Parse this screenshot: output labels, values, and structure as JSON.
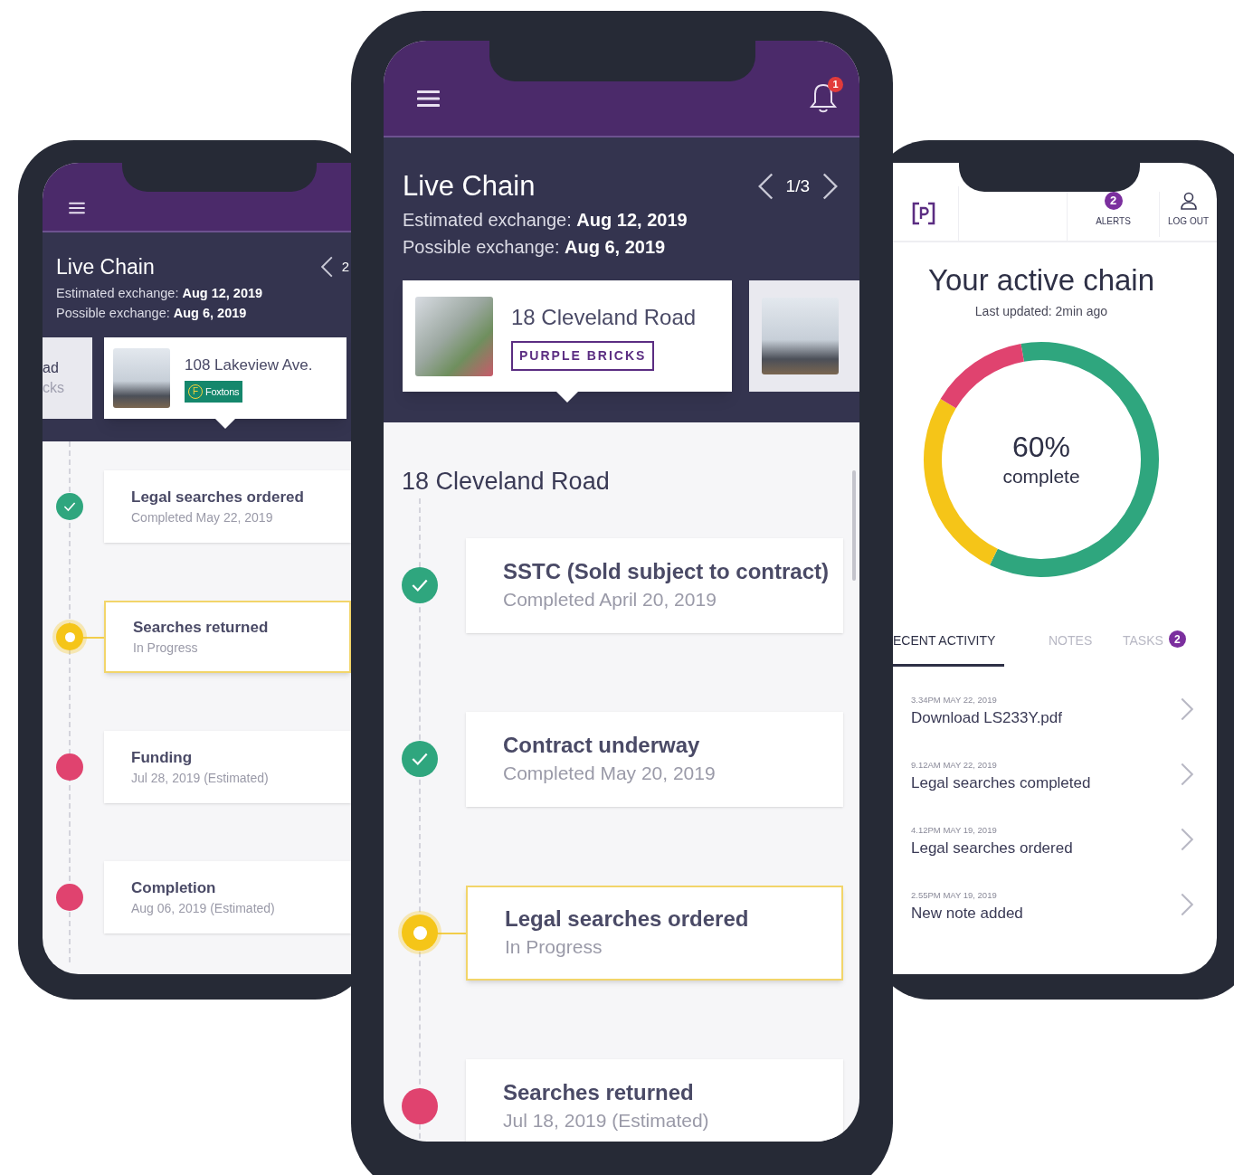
{
  "left_phone": {
    "chain": {
      "title": "Live Chain",
      "page": "2",
      "estimated_label": "Estimated exchange:",
      "estimated_value": "Aug 12, 2019",
      "possible_label": "Possible exchange:",
      "possible_value": "Aug 6, 2019"
    },
    "cards": [
      {
        "kind": "partial",
        "lines": [
          "ad",
          "cks"
        ],
        "selected": false
      },
      {
        "kind": "property",
        "address": "108 Lakeview Ave.",
        "agent": {
          "kind": "foxtons",
          "mark": "F",
          "name": "Foxtons"
        },
        "selected": true
      }
    ],
    "timeline": [
      {
        "title": "Legal searches ordered",
        "detail": "Completed May 22, 2019",
        "kind": "done"
      },
      {
        "title": "Searches returned",
        "detail": "In Progress",
        "kind": "progress"
      },
      {
        "title": "Funding",
        "detail": "Jul 28, 2019 (Estimated)",
        "kind": "estimate"
      },
      {
        "title": "Completion",
        "detail": "Aug 06, 2019 (Estimated)",
        "kind": "estimate"
      }
    ]
  },
  "center_phone": {
    "alerts_count": "1",
    "chain": {
      "title": "Live Chain",
      "page": "1/3",
      "estimated_label": "Estimated exchange:",
      "estimated_value": "Aug 12, 2019",
      "possible_label": "Possible exchange:",
      "possible_value": "Aug 6, 2019"
    },
    "cards": [
      {
        "kind": "property",
        "address": "18 Cleveland Road",
        "agent": {
          "kind": "purplebricks",
          "name": "PURPLE BRICKS"
        },
        "selected": true
      },
      {
        "kind": "photo",
        "selected": false
      }
    ],
    "section_title": "18 Cleveland Road",
    "timeline": [
      {
        "title": "SSTC (Sold subject to contract)",
        "detail": "Completed April 20, 2019",
        "kind": "done"
      },
      {
        "title": "Contract underway",
        "detail": "Completed May 20, 2019",
        "kind": "done"
      },
      {
        "title": "Legal searches ordered",
        "detail": "In Progress",
        "kind": "progress"
      },
      {
        "title": "Searches returned",
        "detail": "Jul 18, 2019 (Estimated)",
        "kind": "estimate"
      }
    ]
  },
  "right_phone": {
    "alerts_count": "2",
    "alerts_label": "ALERTS",
    "logout_label": "LOG OUT",
    "title": "Your active chain",
    "updated": "Last updated: 2min ago",
    "progress": {
      "percent": "60%",
      "caption": "complete"
    },
    "tabs": [
      {
        "label": "ECENT ACTIVITY",
        "selected": true
      },
      {
        "label": "NOTES",
        "selected": false
      },
      {
        "label": "TASKS",
        "selected": false,
        "badge": "2"
      }
    ],
    "activity": [
      {
        "time": "3.34PM MAY 22, 2019",
        "title": "Download LS233Y.pdf"
      },
      {
        "time": "9.12AM MAY 22, 2019",
        "title": "Legal searches completed"
      },
      {
        "time": "4.12PM MAY 19, 2019",
        "title": "Legal searches ordered"
      },
      {
        "time": "2.55PM MAY 19, 2019",
        "title": "New note added"
      }
    ]
  }
}
